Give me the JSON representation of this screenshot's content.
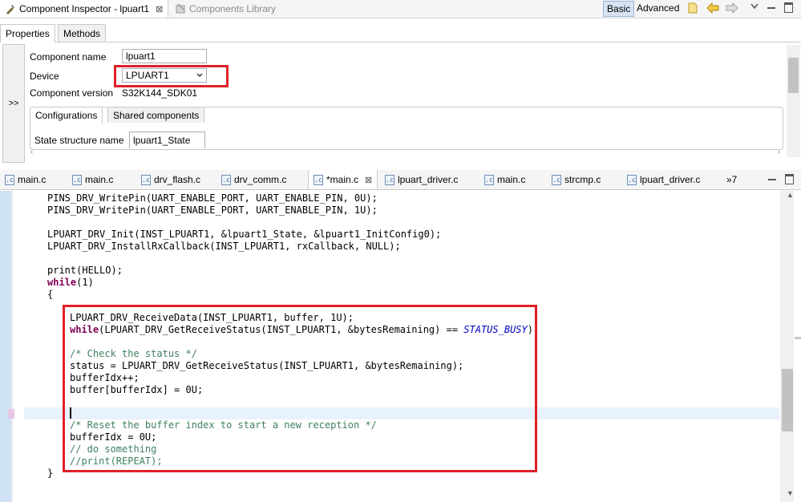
{
  "top_tabs": {
    "inspector_label": "Component Inspector - lpuart1",
    "library_label": "Components Library",
    "basic_label": "Basic",
    "advanced_label": "Advanced"
  },
  "sub_tabs": {
    "properties": "Properties",
    "methods": "Methods"
  },
  "left_rail_label": ">>",
  "form": {
    "component_name_label": "Component name",
    "component_name_value": "lpuart1",
    "device_label": "Device",
    "device_value": "LPUART1",
    "component_version_label": "Component version",
    "component_version_value": "S32K144_SDK01",
    "config_tab": "Configurations",
    "shared_tab": "Shared components",
    "state_label": "State structure name",
    "state_value": "lpuart1_State"
  },
  "editor_tabs": [
    {
      "label": "main.c"
    },
    {
      "label": "main.c"
    },
    {
      "label": "drv_flash.c"
    },
    {
      "label": "drv_comm.c"
    },
    {
      "label": "*main.c"
    },
    {
      "label": "lpuart_driver.c"
    },
    {
      "label": "main.c"
    },
    {
      "label": "strcmp.c"
    },
    {
      "label": "lpuart_driver.c"
    }
  ],
  "overflow_label": "»7",
  "code": {
    "l1": "PINS_DRV_WritePin(UART_ENABLE_PORT, UART_ENABLE_PIN, 0U);",
    "l2": "PINS_DRV_WritePin(UART_ENABLE_PORT, UART_ENABLE_PIN, 1U);",
    "l3": "LPUART_DRV_Init(INST_LPUART1, &lpuart1_State, &lpuart1_InitConfig0);",
    "l4": "LPUART_DRV_InstallRxCallback(INST_LPUART1, rxCallback, NULL);",
    "l5": "print(HELLO);",
    "l6_kw": "while",
    "l6_rest": "(1)",
    "l7": "{",
    "l8": "LPUART_DRV_ReceiveData(INST_LPUART1, buffer, 1U);",
    "l9_kw": "while",
    "l9_rest": "(LPUART_DRV_GetReceiveStatus(INST_LPUART1, &bytesRemaining) == ",
    "l9_const": "STATUS_BUSY",
    "l9_end": ");",
    "l10": "/* Check the status */",
    "l11": "status = LPUART_DRV_GetReceiveStatus(INST_LPUART1, &bytesRemaining);",
    "l12": "bufferIdx++;",
    "l13": "buffer[bufferIdx] = 0U;",
    "l14": "/* Reset the buffer index to start a new reception */",
    "l15": "bufferIdx = 0U;",
    "l16": "// do something",
    "l17": "//print(REPEAT);",
    "l18": "}"
  },
  "colors": {
    "highlight": "#e0202a",
    "keyword": "#7f0055",
    "comment": "#3f7f5f",
    "constant": "#0000c0"
  }
}
